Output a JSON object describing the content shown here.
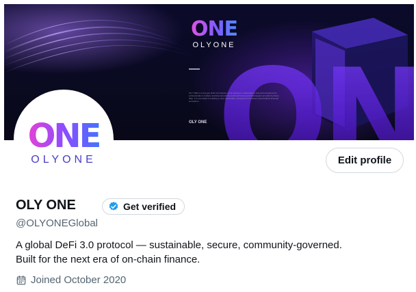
{
  "banner": {
    "logo_text": "ONE",
    "brand_text": "OLYONE",
    "tagline": "OLY ONE",
    "paragraph": "OLY ONE is a next-gen DeFi 3.0 protocol, jointly released, collaboratively built and recognized by professionals in multiple countries around the world with strong technical support provided by Deep Web. It is committed to building a more sustainable, transparent and secure decentralized financial ecosystem.",
    "big_text": "ONE"
  },
  "avatar": {
    "logo_text": "ONE",
    "brand_text": "OLYONE"
  },
  "actions": {
    "edit_profile": "Edit profile",
    "get_verified": "Get verified"
  },
  "profile": {
    "display_name": "OLY ONE",
    "handle": "@OLYONEGlobal",
    "bio_lines": [
      "A global DeFi 3.0 protocol — sustainable, secure, community-governed.",
      "Built for the next era of on-chain finance."
    ],
    "joined": "Joined October 2020"
  },
  "colors": {
    "verified_badge": "#1d9bf0",
    "secondary_text": "#536471",
    "primary_text": "#0f1419",
    "border": "#cfd9de"
  },
  "icons": {
    "verified": "verified-badge-icon",
    "calendar": "calendar-icon"
  }
}
